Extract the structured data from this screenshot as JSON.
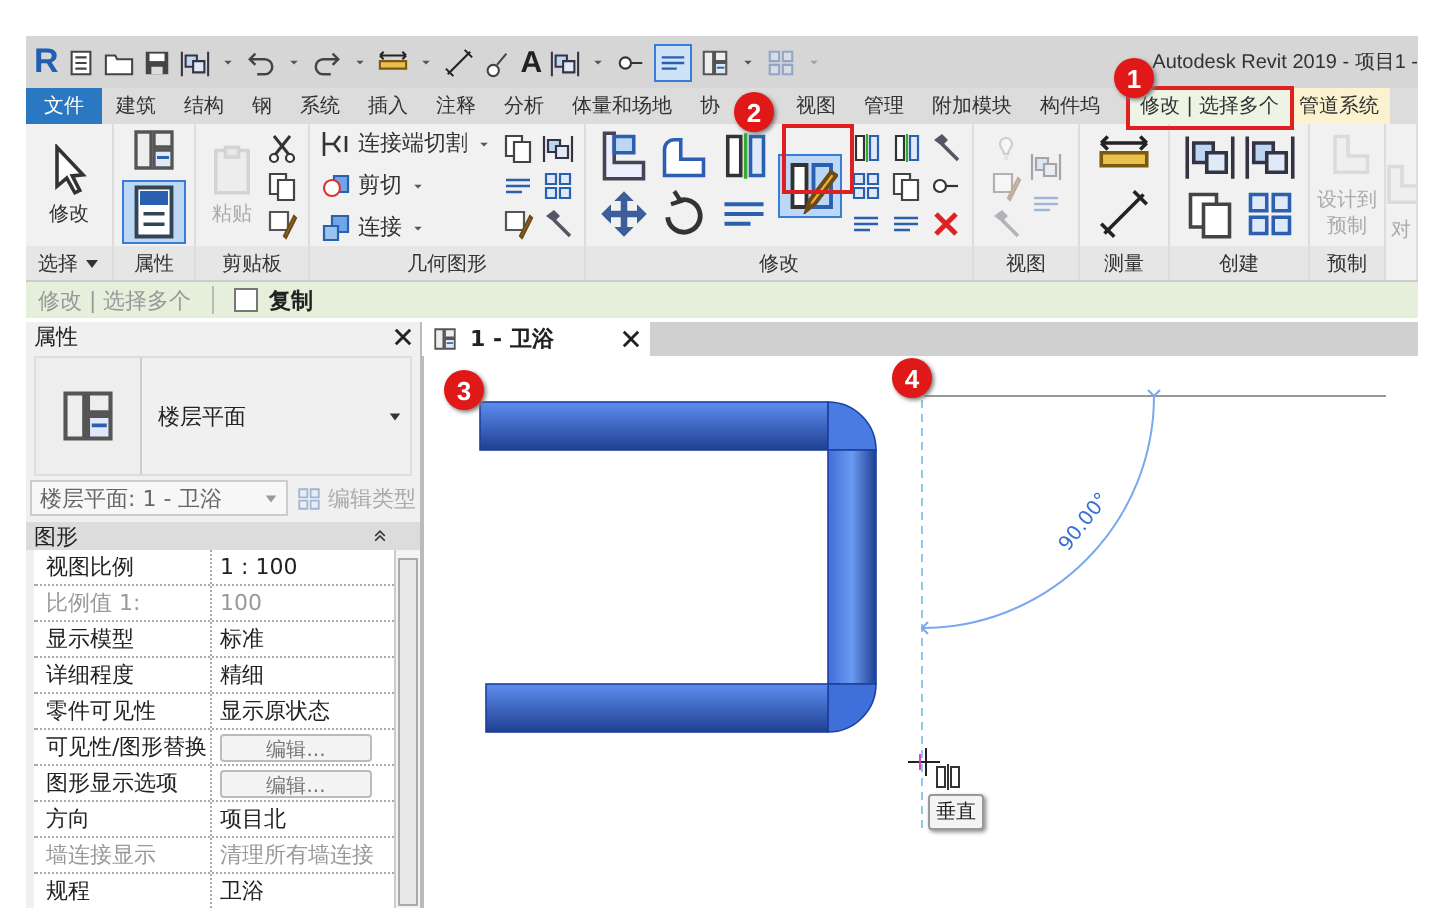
{
  "title_bar": {
    "logo": "R",
    "text_tool": "A",
    "title": "Autodesk Revit 2019 - 项目1 -"
  },
  "tabs": [
    {
      "label": "文件",
      "kind": "file",
      "selected": false
    },
    {
      "label": "建筑",
      "kind": "standard",
      "selected": false
    },
    {
      "label": "结构",
      "kind": "standard",
      "selected": false
    },
    {
      "label": "钢",
      "kind": "standard",
      "selected": false
    },
    {
      "label": "系统",
      "kind": "standard",
      "selected": false
    },
    {
      "label": "插入",
      "kind": "standard",
      "selected": false
    },
    {
      "label": "注释",
      "kind": "standard",
      "selected": false
    },
    {
      "label": "分析",
      "kind": "standard",
      "selected": false
    },
    {
      "label": "体量和场地",
      "kind": "standard",
      "selected": false
    },
    {
      "label": "协",
      "kind": "standard",
      "selected": false
    },
    {
      "label": "视图",
      "kind": "standard",
      "selected": false
    },
    {
      "label": "管理",
      "kind": "standard",
      "selected": false
    },
    {
      "label": "附加模块",
      "kind": "standard",
      "selected": false
    },
    {
      "label": "构件坞",
      "kind": "standard",
      "selected": false
    },
    {
      "label": "修改 | 选择多个",
      "kind": "contextual",
      "selected": true
    },
    {
      "label": "管道系统",
      "kind": "contextual",
      "selected": false
    }
  ],
  "ribbon": [
    {
      "label": "选择",
      "dropdown": true,
      "tools": [
        {
          "kind": "big",
          "label": "修改",
          "disabled": false
        }
      ]
    },
    {
      "label": "属性",
      "tools": [
        {
          "kind": "toggle",
          "on": true
        }
      ]
    },
    {
      "label": "剪贴板",
      "tools": [
        {
          "kind": "big",
          "label": "粘贴",
          "disabled": true
        }
      ]
    },
    {
      "label": "几何图形",
      "tools": [
        {
          "kind": "small",
          "label": "连接端切割",
          "disabled": false
        },
        {
          "kind": "small",
          "label": "剪切",
          "disabled": false
        },
        {
          "kind": "small",
          "label": "连接",
          "disabled": false
        }
      ]
    },
    {
      "label": "修改",
      "tools": [
        {
          "kind": "toggle",
          "on": true
        }
      ]
    },
    {
      "label": "视图"
    },
    {
      "label": "测量"
    },
    {
      "label": "创建"
    },
    {
      "label": "预制",
      "tools": [
        {
          "kind": "big",
          "label": "设计到预制",
          "disabled": true
        }
      ]
    },
    {
      "tools": [
        {
          "kind": "big",
          "label": "对",
          "disabled": true
        }
      ]
    }
  ],
  "options_bar": {
    "mode": "修改 | 选择多个",
    "copy": {
      "label": "复制",
      "checked": false
    }
  },
  "properties": {
    "title": "属性",
    "type_name": "楼层平面",
    "instance": "楼层平面: 1 - 卫浴",
    "edit_type": "编辑类型",
    "section": "图形",
    "rows": [
      {
        "name": "视图比例",
        "value": "1 : 100",
        "kind": "text",
        "disabled": false
      },
      {
        "name": "比例值 1:",
        "value": "100",
        "kind": "text",
        "disabled": true
      },
      {
        "name": "显示模型",
        "value": "标准",
        "kind": "text",
        "disabled": false
      },
      {
        "name": "详细程度",
        "value": "精细",
        "kind": "text",
        "disabled": false
      },
      {
        "name": "零件可见性",
        "value": "显示原状态",
        "kind": "text",
        "disabled": false
      },
      {
        "name": "可见性/图形替换",
        "value": "编辑...",
        "kind": "button",
        "disabled": false
      },
      {
        "name": "图形显示选项",
        "value": "编辑...",
        "kind": "button",
        "disabled": false
      },
      {
        "name": "方向",
        "value": "项目北",
        "kind": "text",
        "disabled": false
      },
      {
        "name": "墙连接显示",
        "value": "清理所有墙连接",
        "kind": "text",
        "disabled": true
      },
      {
        "name": "规程",
        "value": "卫浴",
        "kind": "text",
        "disabled": false
      }
    ]
  },
  "view_tab": {
    "label": "1 - 卫浴"
  },
  "canvas": {
    "angle": "90.00°",
    "tooltip": "垂直"
  },
  "callouts": [
    "1",
    "2",
    "3",
    "4"
  ]
}
